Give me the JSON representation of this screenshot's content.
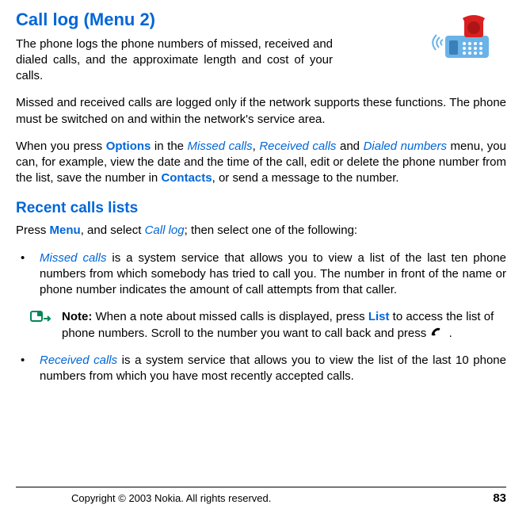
{
  "title": "Call log (Menu 2)",
  "intro1": "The phone logs the phone numbers of missed, received and dialed calls, and the approximate length and cost of your calls.",
  "intro2": "Missed and received calls are logged only if the network supports these functions.  The phone must be switched on and within the network's service area.",
  "para3_pre": "When you press ",
  "para3_options": "Options",
  "para3_mid1": " in the ",
  "para3_missed": "Missed calls",
  "para3_comma1": ", ",
  "para3_received": "Received calls",
  "para3_and": " and ",
  "para3_dialed": "Dialed numbers",
  "para3_mid2": " menu, you can, for example, view the date and the time of the call, edit or delete the phone number from the list, save the number in ",
  "para3_contacts": "Contacts",
  "para3_end": ", or send a message to the number.",
  "subtitle": "Recent calls lists",
  "recent_pre": "Press ",
  "recent_menu": "Menu",
  "recent_mid": ", and select ",
  "recent_calllog": "Call log",
  "recent_end": "; then select one of the following:",
  "bullet_char": "•",
  "b1_italic": "Missed calls",
  "b1_text": "  is a system service that allows you to view a list of the last ten phone numbers from which somebody has tried to call you. The number in front of the name or phone number indicates the amount of call attempts from that caller.",
  "note_label": "Note:",
  "note_pre": "  When a note about missed calls is displayed, press ",
  "note_list": "List",
  "note_mid": " to access the list of phone numbers. Scroll to the number you want to call back and press  ",
  "note_end": " .",
  "b2_italic": "Received calls",
  "b2_text": " is a system service that allows you to view the list of the last 10 phone numbers from which you have most recently accepted calls.",
  "copyright": "Copyright © 2003 Nokia. All rights reserved.",
  "page": "83"
}
